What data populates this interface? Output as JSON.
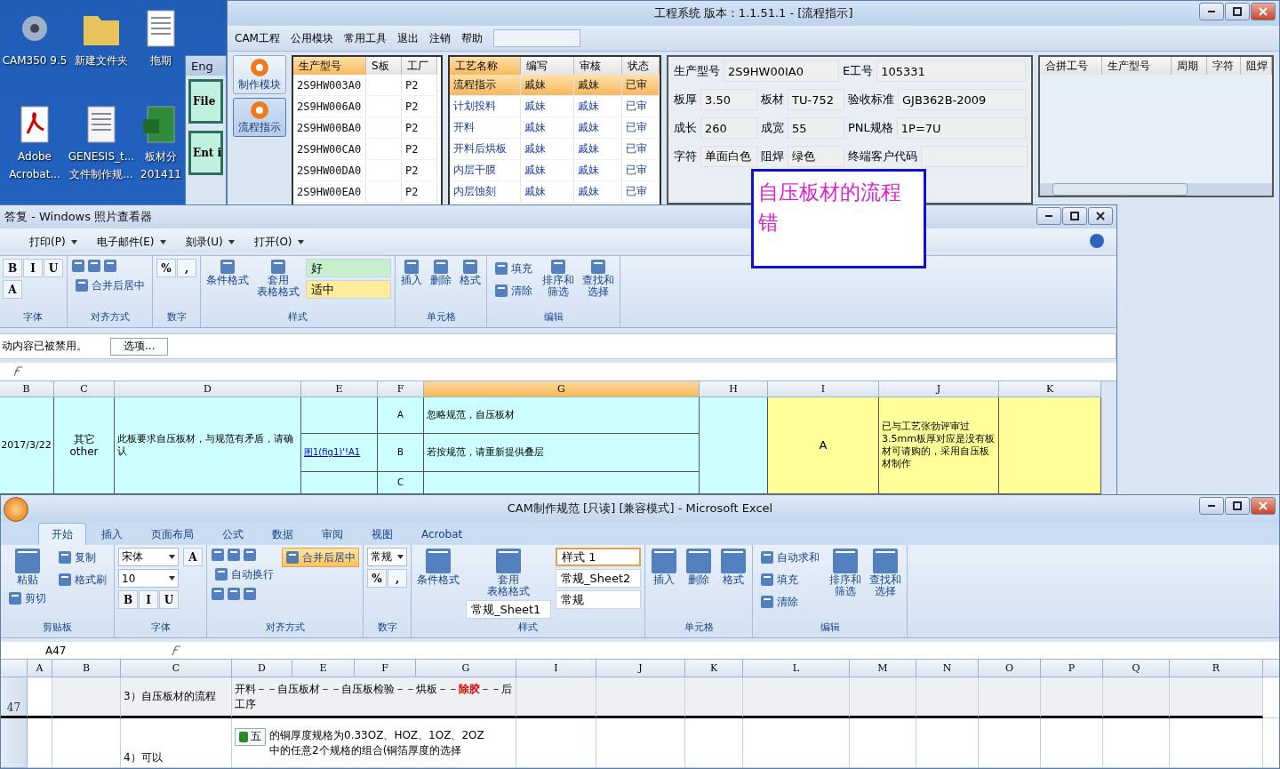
{
  "desktop": {
    "icons": [
      {
        "kind": "app",
        "lines": [
          "CAM350 9.5"
        ]
      },
      {
        "kind": "folder",
        "lines": [
          "新建文件夹"
        ]
      },
      {
        "kind": "sheet",
        "lines": [
          "拖期"
        ]
      },
      {
        "kind": "pdf",
        "lines": [
          "Adobe",
          "Acrobat..."
        ]
      },
      {
        "kind": "scan",
        "lines": [
          "GENESIS_t...",
          "文件制作规..."
        ]
      },
      {
        "kind": "excel",
        "lines": [
          "板材分",
          "201411"
        ]
      }
    ]
  },
  "eng_window": {
    "title": "Eng",
    "buttons": [
      "File",
      "Ent i"
    ]
  },
  "cam_window": {
    "title": "工程系统    版本：1.1.51.1 - [流程指示]",
    "menu": [
      "CAM工程",
      "公用模块",
      "常用工具",
      "退出",
      "注销",
      "帮助"
    ],
    "nav": [
      {
        "label": "制作模块",
        "selected": false
      },
      {
        "label": "流程指示",
        "selected": true
      }
    ],
    "orders": {
      "columns": [
        "生产型号",
        "S板",
        "工厂"
      ],
      "rows": [
        {
          "model": "2S9HW003A0",
          "factory": "P2"
        },
        {
          "model": "2S9HW006A0",
          "factory": "P2"
        },
        {
          "model": "2S9HW00BA0",
          "factory": "P2"
        },
        {
          "model": "2S9HW00CA0",
          "factory": "P2"
        },
        {
          "model": "2S9HW00DA0",
          "factory": "P2"
        },
        {
          "model": "2S9HW00EA0",
          "factory": "P2"
        }
      ]
    },
    "process": {
      "columns": [
        "工艺名称",
        "编写",
        "审核",
        "状态"
      ],
      "rows": [
        {
          "name": "流程指示",
          "author": "戚妹",
          "reviewer": "戚妹",
          "status": "已审",
          "selected": true
        },
        {
          "name": "计划投料",
          "author": "戚妹",
          "reviewer": "戚妹",
          "status": "已审",
          "selected": false
        },
        {
          "name": "开料",
          "author": "戚妹",
          "reviewer": "戚妹",
          "status": "已审",
          "selected": false
        },
        {
          "name": "开料后烘板",
          "author": "戚妹",
          "reviewer": "戚妹",
          "status": "已审",
          "selected": false
        },
        {
          "name": "内层干膜",
          "author": "戚妹",
          "reviewer": "戚妹",
          "status": "已审",
          "selected": false
        },
        {
          "name": "内层蚀刻",
          "author": "戚妹",
          "reviewer": "戚妹",
          "status": "已审",
          "selected": false
        }
      ]
    },
    "info": [
      [
        {
          "label": "生产型号",
          "value": "2S9HW00IA0"
        },
        {
          "label": "E工号",
          "value": "105331"
        }
      ],
      [
        {
          "label": "板厚",
          "value": "3.50"
        },
        {
          "label": "板材",
          "value": "TU-752"
        },
        {
          "label": "验收标准",
          "value": "GJB362B-2009"
        }
      ],
      [
        {
          "label": "成长",
          "value": "260"
        },
        {
          "label": "成宽",
          "value": "55"
        },
        {
          "label": "PNL规格",
          "value": "1P=7U"
        }
      ],
      [
        {
          "label": "字符",
          "value": "单面白色"
        },
        {
          "label": "阻焊",
          "value": "绿色"
        },
        {
          "label": "终端客户代码"
        }
      ]
    ],
    "merge_table": {
      "columns": [
        "合拼工号",
        "生产型号",
        "周期",
        "字符",
        "阻焊"
      ]
    }
  },
  "note": {
    "text": "自压板材的流程错"
  },
  "viewer": {
    "title": "答复 - Windows 照片查看器",
    "toolbar": [
      "打印(P)",
      "电子邮件(E)",
      "刻录(U)",
      "打开(O)"
    ],
    "ribbon": [
      {
        "label": "字体",
        "items": [
          {
            "kind": "glyphs",
            "glyphs": [
              "B",
              "I",
              "U"
            ]
          },
          {
            "kind": "glyphs",
            "glyphs": [
              "A"
            ]
          }
        ]
      },
      {
        "label": "对齐方式",
        "items": [
          {
            "kind": "icons"
          },
          {
            "kind": "small",
            "text": "合并后居中"
          }
        ]
      },
      {
        "label": "数字",
        "items": [
          {
            "kind": "glyphs",
            "glyphs": [
              "%",
              ","
            ]
          }
        ]
      },
      {
        "label": "样式",
        "items": [
          {
            "kind": "big",
            "lines": [
              "条件格式"
            ]
          },
          {
            "kind": "big",
            "lines": [
              "套用",
              "表格格式"
            ]
          },
          {
            "kind": "style",
            "text": "好",
            "color": "#c6efce"
          },
          {
            "kind": "style",
            "text": "适中",
            "color": "#ffeb9c"
          }
        ]
      },
      {
        "label": "单元格",
        "items": [
          {
            "kind": "big",
            "lines": [
              "插入"
            ]
          },
          {
            "kind": "big",
            "lines": [
              "删除"
            ]
          },
          {
            "kind": "big",
            "lines": [
              "格式"
            ]
          }
        ]
      },
      {
        "label": "编辑",
        "items": [
          {
            "kind": "small",
            "text": "填充"
          },
          {
            "kind": "small",
            "text": "清除"
          },
          {
            "kind": "big",
            "lines": [
              "排序和",
              "筛选"
            ]
          },
          {
            "kind": "big",
            "lines": [
              "查找和",
              "选择"
            ]
          }
        ]
      }
    ],
    "security": {
      "text": "动内容已被禁用。",
      "button": "选项..."
    },
    "sheet": {
      "columns": [
        "B",
        "C",
        "D",
        "E",
        "F",
        "G",
        "H",
        "I",
        "J",
        "K"
      ],
      "date": "2017/3/22",
      "category": "其它\nother",
      "question": "此板要求自压板材，与规范有矛盾，请确认",
      "link": "图1(fig1)'!A1",
      "options": [
        {
          "letter": "A",
          "text": "忽略规范，自压板材"
        },
        {
          "letter": "B",
          "text": "若按规范，请重新提供叠层"
        },
        {
          "letter": "C"
        }
      ],
      "answer": "A",
      "reply": "已与工艺张勃评审过3.5mm板厚对应是没有板材可请购的，采用自压板材制作"
    }
  },
  "excel": {
    "title": "CAM制作规范  [只读]  [兼容模式] - Microsoft Excel",
    "tabs": [
      {
        "label": "开始",
        "selected": true
      },
      {
        "label": "插入",
        "selected": false
      },
      {
        "label": "页面布局",
        "selected": false
      },
      {
        "label": "公式",
        "selected": false
      },
      {
        "label": "数据",
        "selected": false
      },
      {
        "label": "审阅",
        "selected": false
      },
      {
        "label": "视图",
        "selected": false
      },
      {
        "label": "Acrobat",
        "selected": false
      }
    ],
    "ribbon": [
      {
        "label": "剪贴板",
        "items": [
          {
            "kind": "big",
            "lines": [
              "粘贴"
            ]
          },
          {
            "kind": "small",
            "text": "剪切"
          },
          {
            "kind": "small",
            "text": "复制"
          },
          {
            "kind": "small",
            "text": "格式刷"
          }
        ]
      },
      {
        "label": "字体",
        "items": [
          {
            "kind": "field",
            "text": "宋体"
          },
          {
            "kind": "field",
            "text": "10"
          },
          {
            "kind": "glyphs",
            "glyphs": [
              "B",
              "I",
              "U"
            ]
          },
          {
            "kind": "glyphs",
            "glyphs": [
              "A"
            ]
          }
        ]
      },
      {
        "label": "对齐方式",
        "items": [
          {
            "kind": "icons"
          },
          {
            "kind": "small",
            "text": "自动换行"
          },
          {
            "kind": "icons"
          },
          {
            "kind": "small",
            "text": "合并后居中",
            "selected": true
          }
        ]
      },
      {
        "label": "数字",
        "items": [
          {
            "kind": "field",
            "text": "常规"
          },
          {
            "kind": "glyphs",
            "glyphs": [
              "%",
              ","
            ]
          }
        ]
      },
      {
        "label": "样式",
        "items": [
          {
            "kind": "big",
            "lines": [
              "条件格式"
            ]
          },
          {
            "kind": "big",
            "lines": [
              "套用",
              "表格格式"
            ]
          },
          {
            "kind": "style",
            "text": "常规_Sheet1",
            "color": "#ffffff",
            "selected": false
          },
          {
            "kind": "style",
            "text": "样式 1",
            "color": "#ffffff",
            "selected": true
          },
          {
            "kind": "style",
            "text": "常规_Sheet2",
            "color": "#ffffff",
            "selected": false
          },
          {
            "kind": "style",
            "text": "常规",
            "color": "#ffffff",
            "selected": false
          }
        ]
      },
      {
        "label": "单元格",
        "items": [
          {
            "kind": "big",
            "lines": [
              "插入"
            ]
          },
          {
            "kind": "big",
            "lines": [
              "删除"
            ]
          },
          {
            "kind": "big",
            "lines": [
              "格式"
            ]
          }
        ]
      },
      {
        "label": "编辑",
        "items": [
          {
            "kind": "small",
            "text": "自动求和"
          },
          {
            "kind": "small",
            "text": "填充"
          },
          {
            "kind": "small",
            "text": "清除"
          },
          {
            "kind": "big",
            "lines": [
              "排序和",
              "筛选"
            ]
          },
          {
            "kind": "big",
            "lines": [
              "查找和",
              "选择"
            ]
          }
        ]
      }
    ],
    "name_box": "A47",
    "columns": [
      "A",
      "B",
      "C",
      "D",
      "E",
      "F",
      "G",
      "I",
      "J",
      "K",
      "L",
      "M",
      "N",
      "O",
      "P",
      "Q",
      "R"
    ],
    "rows": [
      {
        "number": "47",
        "step": "3）自压板材的流程",
        "flow": "开料－－自压板材－－自压板检验－－烘板－－**除胶**－－后工序"
      },
      {
        "step": "4）可以",
        "flow": "的铜厚度规格为0.33OZ、HOZ、1OZ、2OZ\n中的任意2个规格的组合(铜箔厚度的选择"
      }
    ],
    "ime": {
      "label": "五"
    }
  }
}
